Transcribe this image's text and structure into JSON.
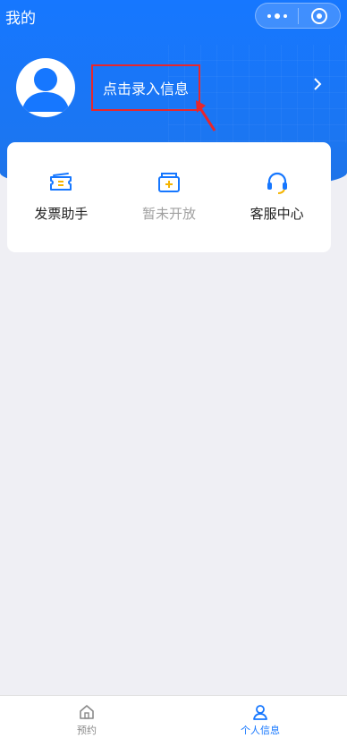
{
  "nav": {
    "title": "我的"
  },
  "profile": {
    "prompt": "点击录入信息"
  },
  "quick_actions": [
    {
      "label": "发票助手",
      "icon": "invoice-icon",
      "enabled": true
    },
    {
      "label": "暂未开放",
      "icon": "folder-add-icon",
      "enabled": false
    },
    {
      "label": "客服中心",
      "icon": "headset-icon",
      "enabled": true
    }
  ],
  "tabbar": {
    "items": [
      {
        "label": "预约",
        "icon": "home-icon",
        "active": false
      },
      {
        "label": "个人信息",
        "icon": "person-icon",
        "active": true
      }
    ]
  },
  "colors": {
    "brand": "#1677ff",
    "annotation": "#e8262b",
    "accent_yellow": "#f5b400"
  }
}
